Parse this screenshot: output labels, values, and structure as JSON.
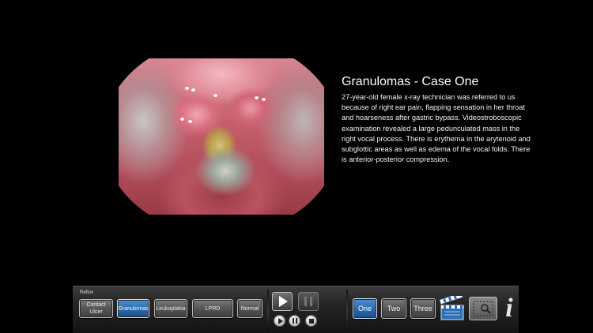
{
  "case": {
    "title": "Granulomas - Case One",
    "description": "27-year-old female x-ray technician was referred to us because of right ear pain, flapping sensation in her throat and hoarseness after gastric bypass. Videostroboscopic examination revealed a large pedunculated mass in the right vocal process. There is erythema in the arytenoid and subglottic areas as well as edema of the vocal folds. There is anterior-posterior compression."
  },
  "toolbar": {
    "section_label": "Reflux",
    "categories": [
      {
        "label": "Contact Ulcer",
        "active": false
      },
      {
        "label": "Granulomas",
        "active": true
      },
      {
        "label": "Leukoplakia",
        "active": false
      },
      {
        "label": "LPRD",
        "active": false
      },
      {
        "label": "Normal",
        "active": false
      }
    ],
    "cases": [
      {
        "label": "One",
        "active": true
      },
      {
        "label": "Two",
        "active": false
      },
      {
        "label": "Three",
        "active": false
      }
    ]
  },
  "icons": {
    "play": "play-icon",
    "pause": "pause-icon",
    "stop": "stop-icon",
    "clapperboard": "clapperboard-icon",
    "search": "search-icon",
    "info": "info-icon"
  },
  "colors": {
    "active_button": "#2666ac",
    "background": "#000000"
  }
}
